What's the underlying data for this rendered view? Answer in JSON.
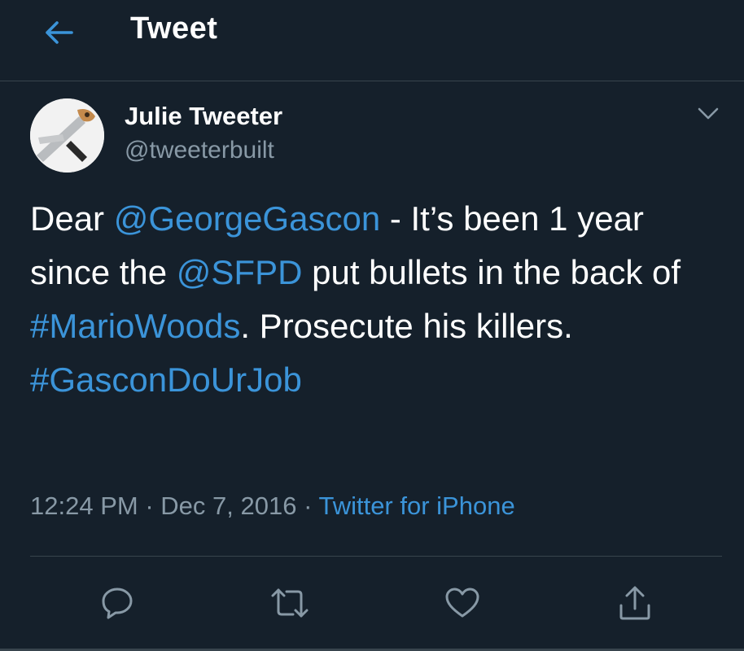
{
  "header": {
    "title": "Tweet",
    "back_icon": "arrow-left-icon"
  },
  "tweet": {
    "author": {
      "display_name": "Julie Tweeter",
      "handle": "@tweeterbuilt"
    },
    "text_segments": [
      {
        "text": "Dear ",
        "type": "text"
      },
      {
        "text": "@GeorgeGascon",
        "type": "mention"
      },
      {
        "text": " - It’s been 1 year since the ",
        "type": "text"
      },
      {
        "text": "@SFPD",
        "type": "mention"
      },
      {
        "text": " put bullets in the back of ",
        "type": "text"
      },
      {
        "text": "#MarioWoods",
        "type": "hashtag"
      },
      {
        "text": ". Prosecute his killers. ",
        "type": "text"
      },
      {
        "text": "#GasconDoUrJob",
        "type": "hashtag"
      }
    ],
    "time": "12:24 PM",
    "date": "Dec 7, 2016",
    "separator": "·",
    "source": "Twitter for iPhone"
  },
  "actions": {
    "reply_icon": "reply-icon",
    "retweet_icon": "retweet-icon",
    "like_icon": "heart-icon",
    "share_icon": "share-icon"
  },
  "colors": {
    "background": "#15202b",
    "accent": "#3b94d9",
    "secondary_text": "#8899a6",
    "divider": "#38444d"
  }
}
